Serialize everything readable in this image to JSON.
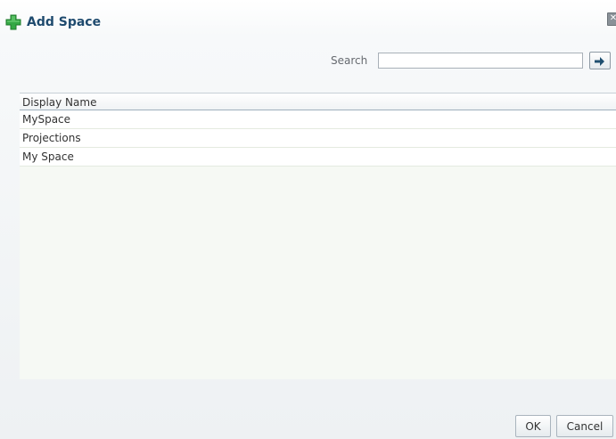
{
  "dialog": {
    "title": "Add Space",
    "close_glyph": "✕"
  },
  "search": {
    "label": "Search",
    "value": "",
    "placeholder": "",
    "go_icon": "arrow-right-icon"
  },
  "table": {
    "column_header": "Display Name",
    "rows": [
      "MySpace",
      "Projections",
      "My Space"
    ]
  },
  "footer": {
    "ok_label": "OK",
    "cancel_label": "Cancel"
  },
  "colors": {
    "title": "#1e4a6e",
    "add_icon": "#35a845",
    "go_arrow": "#1f4f70"
  }
}
